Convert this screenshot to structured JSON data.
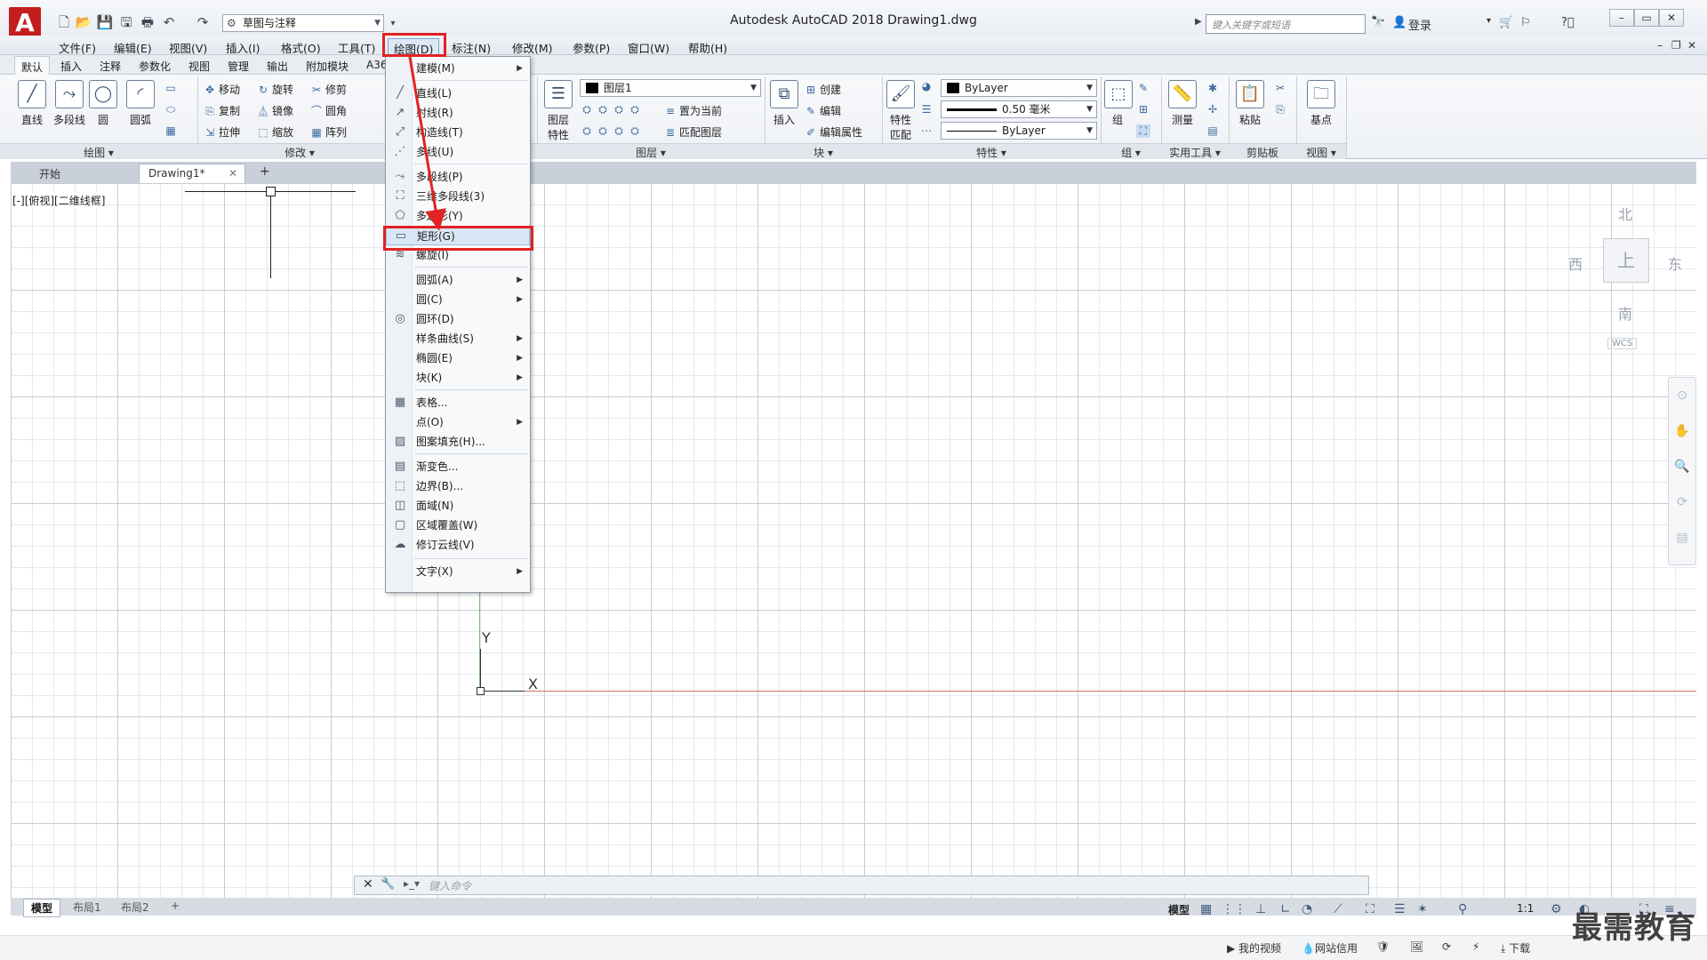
{
  "window": {
    "title": "Autodesk AutoCAD 2018    Drawing1.dwg",
    "app_logo": "A",
    "workspace": "草图与注释",
    "search_placeholder": "键入关键字或短语",
    "login": "登录"
  },
  "menubar": {
    "items": [
      "文件(F)",
      "编辑(E)",
      "视图(V)",
      "插入(I)",
      "格式(O)",
      "工具(T)",
      "绘图(D)",
      "标注(N)",
      "修改(M)",
      "参数(P)",
      "窗口(W)",
      "帮助(H)"
    ]
  },
  "ribbon": {
    "tabs": [
      "默认",
      "插入",
      "注释",
      "参数化",
      "视图",
      "管理",
      "输出",
      "附加模块",
      "A36"
    ],
    "draw_panel": {
      "title": "绘图 ▾",
      "tools": [
        "直线",
        "多段线",
        "圆",
        "圆弧"
      ]
    },
    "modify_panel": {
      "title": "修改 ▾",
      "tools": [
        "移动",
        "旋转",
        "修剪",
        "复制",
        "镜像",
        "圆角",
        "拉伸",
        "缩放",
        "阵列"
      ]
    },
    "layers_panel": {
      "title": "图层 ▾",
      "layer_props": "图层\n特性",
      "layer_name": "图层1",
      "tools": [
        "置为当前",
        "匹配图层"
      ]
    },
    "block_panel": {
      "title": "块 ▾",
      "insert": "插入",
      "tools": [
        "创建",
        "编辑",
        "编辑属性"
      ]
    },
    "properties_panel": {
      "title": "特性 ▾",
      "match": "特性\n匹配",
      "color": "ByLayer",
      "lineweight": "0.50 毫米",
      "linetype": "ByLayer"
    },
    "groups_panel": {
      "title": "组 ▾",
      "group": "组"
    },
    "utilities_panel": {
      "title": "实用工具 ▾",
      "measure": "测量"
    },
    "clipboard_panel": {
      "title": "剪贴板",
      "paste": "粘贴"
    },
    "view_panel": {
      "title": "视图 ▾",
      "base": "基点"
    }
  },
  "doc_tabs": [
    "开始",
    "Drawing1*"
  ],
  "viewport_label": "[-][俯视][二维线框]",
  "viewcube": {
    "north": "北",
    "west": "西",
    "east": "东",
    "south": "南",
    "top": "上",
    "wcs": "WCS"
  },
  "axis": {
    "x": "X",
    "y": "Y"
  },
  "draw_menu": {
    "items": [
      {
        "label": "建模(M)",
        "icon": "none",
        "sub": true
      },
      {
        "label": "直线(L)",
        "icon": "line-icon",
        "sub": false
      },
      {
        "label": "射线(R)",
        "icon": "ray-icon",
        "sub": false
      },
      {
        "label": "构造线(T)",
        "icon": "xline-icon",
        "sub": false
      },
      {
        "label": "多线(U)",
        "icon": "mline-icon",
        "sub": false
      },
      {
        "label": "多段线(P)",
        "icon": "polyline-icon",
        "sub": false
      },
      {
        "label": "三维多段线(3)",
        "icon": "3dpoly-icon",
        "sub": false
      },
      {
        "label": "多边形(Y)",
        "icon": "polygon-icon",
        "sub": false
      },
      {
        "label": "矩形(G)",
        "icon": "rectangle-icon",
        "sub": false
      },
      {
        "label": "螺旋(I)",
        "icon": "helix-icon",
        "sub": false
      },
      {
        "label": "圆弧(A)",
        "icon": "none",
        "sub": true
      },
      {
        "label": "圆(C)",
        "icon": "none",
        "sub": true
      },
      {
        "label": "圆环(D)",
        "icon": "donut-icon",
        "sub": false
      },
      {
        "label": "样条曲线(S)",
        "icon": "none",
        "sub": true
      },
      {
        "label": "椭圆(E)",
        "icon": "none",
        "sub": true
      },
      {
        "label": "块(K)",
        "icon": "none",
        "sub": true
      },
      {
        "label": "表格...",
        "icon": "table-icon",
        "sub": false
      },
      {
        "label": "点(O)",
        "icon": "none",
        "sub": true
      },
      {
        "label": "图案填充(H)...",
        "icon": "hatch-icon",
        "sub": false
      },
      {
        "label": "渐变色...",
        "icon": "gradient-icon",
        "sub": false
      },
      {
        "label": "边界(B)...",
        "icon": "boundary-icon",
        "sub": false
      },
      {
        "label": "面域(N)",
        "icon": "region-icon",
        "sub": false
      },
      {
        "label": "区域覆盖(W)",
        "icon": "wipeout-icon",
        "sub": false
      },
      {
        "label": "修订云线(V)",
        "icon": "revcloud-icon",
        "sub": false
      },
      {
        "label": "文字(X)",
        "icon": "none",
        "sub": true
      }
    ],
    "highlighted": "矩形(G)"
  },
  "command_line": {
    "placeholder": "键入命令"
  },
  "layout_tabs": [
    "模型",
    "布局1",
    "布局2"
  ],
  "status": {
    "model": "模型",
    "scale": "1:1"
  },
  "bottom_strip": {
    "my_video": "我的视频",
    "net_credit": "网站信用",
    "download": "下载"
  },
  "watermark": "最需教育",
  "colors": {
    "accent_red": "#e12323",
    "highlight": "#d9e6f5",
    "brand": "#c41d1d"
  }
}
